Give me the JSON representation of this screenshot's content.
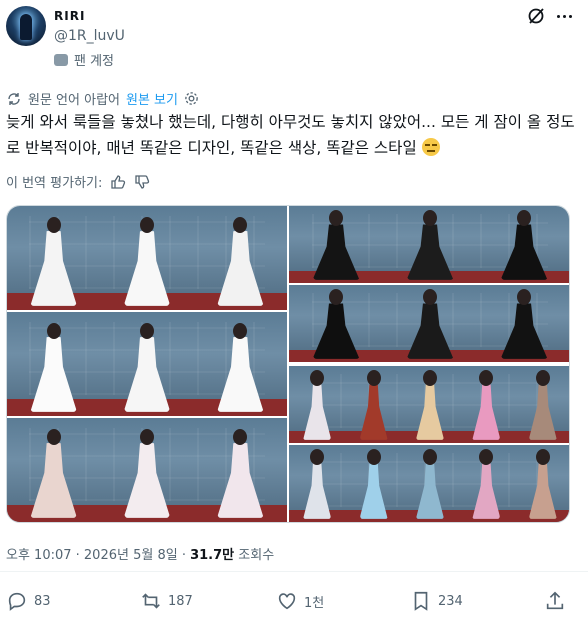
{
  "user": {
    "display_name": "RIRI",
    "handle": "@1R_luvU",
    "account_type": "팬 계정"
  },
  "translation": {
    "source_note": "원문 언어 아랍어",
    "show_original_link": "원본 보기",
    "rate_label": "이 번역 평가하기:"
  },
  "tweet": {
    "text": "늦게 와서 룩들을 놓쳤나 했는데, 다행히 아무것도 놓치지 않았어... 모든 게 잠이 올 정도로 반복적이야, 매년 똑같은 디자인, 똑같은 색상, 똑같은 스타일"
  },
  "media": {
    "left_panels": [
      {
        "gowns": [
          "#f4f4f4",
          "#f8f8f8",
          "#f2f2f2"
        ]
      },
      {
        "gowns": [
          "#fbfbfb",
          "#f6f6f6",
          "#f9f9f9"
        ]
      },
      {
        "gowns": [
          "#e9d5cf",
          "#f3ecef",
          "#f1e6ec"
        ]
      }
    ],
    "right_panels": [
      {
        "gowns": [
          "#141414",
          "#1c1c1c",
          "#101010"
        ]
      },
      {
        "gowns": [
          "#0f0f0f",
          "#1a1a1a",
          "#121212"
        ]
      },
      {
        "gowns": [
          "#e9e4ea",
          "#a23a2a",
          "#e6caa0",
          "#e99ac0",
          "#a78a7a"
        ]
      },
      {
        "gowns": [
          "#dfe3ea",
          "#9fd0ea",
          "#8fb8cf",
          "#e2a7c3",
          "#c7a08f"
        ]
      }
    ]
  },
  "meta": {
    "time": "오후 10:07 · 2026년 5월 8일 · ",
    "views": "31.7만",
    "views_label": " 조회수"
  },
  "actions": {
    "replies": "83",
    "retweets": "187",
    "likes": "1천",
    "bookmarks": "234"
  },
  "colors": {
    "accent": "#1d9bf0",
    "muted": "#536471",
    "carpet": "#8b2b2b",
    "backdrop": "#5b7c95"
  }
}
